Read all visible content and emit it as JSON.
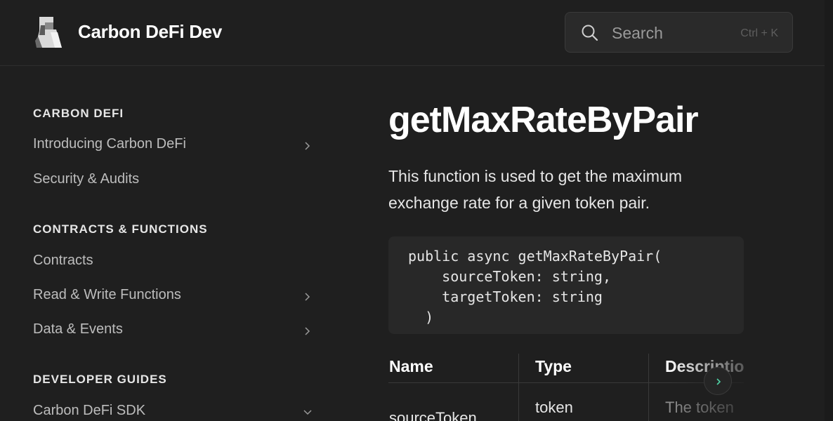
{
  "header": {
    "site_title": "Carbon DeFi Dev",
    "search": {
      "placeholder": "Search",
      "shortcut": "Ctrl + K"
    }
  },
  "sidebar": {
    "sections": [
      {
        "title": "CARBON DEFI",
        "items": [
          {
            "label": "Introducing Carbon DeFi",
            "chevron": "right"
          },
          {
            "label": "Security & Audits",
            "chevron": "none"
          }
        ]
      },
      {
        "title": "CONTRACTS & FUNCTIONS",
        "items": [
          {
            "label": "Contracts",
            "chevron": "none"
          },
          {
            "label": "Read & Write Functions",
            "chevron": "right"
          },
          {
            "label": "Data & Events",
            "chevron": "right"
          }
        ]
      },
      {
        "title": "DEVELOPER GUIDES",
        "items": [
          {
            "label": "Carbon DeFi SDK",
            "chevron": "down"
          }
        ]
      }
    ]
  },
  "main": {
    "title": "getMaxRateByPair",
    "lead": "This function is used to get the maximum exchange rate for a given token pair.",
    "code": "public async getMaxRateByPair(\n    sourceToken: string,\n    targetToken: string\n  )",
    "table": {
      "headers": [
        "Name",
        "Type",
        "Description"
      ],
      "rows": [
        [
          "sourceToken",
          "token",
          "The token"
        ]
      ]
    }
  },
  "colors": {
    "background": "#1f1f1f",
    "code_background": "#282828",
    "accent": "#4fd1a5"
  }
}
